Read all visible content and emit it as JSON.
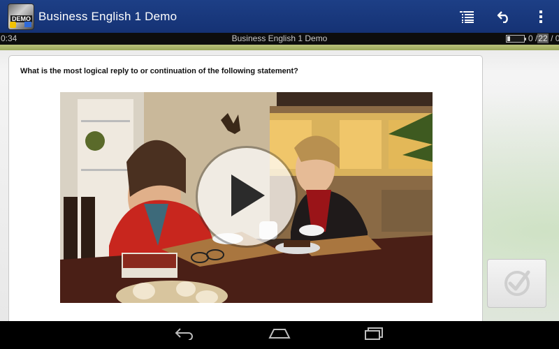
{
  "action_bar": {
    "title": "Business English 1 Demo",
    "icon_badge_text": "DEMO",
    "actions": [
      {
        "icon": "list-icon"
      },
      {
        "icon": "undo-icon"
      },
      {
        "icon": "overflow-menu-icon"
      }
    ]
  },
  "progress": {
    "timer": "0:34",
    "lesson_title": "Business English 1 Demo",
    "score_current": "0",
    "score_sep": "/",
    "score_total": "22",
    "score_extra": "/ 0"
  },
  "question": {
    "prompt": "What is the most logical reply to or continuation of the following statement?"
  },
  "video": {
    "play_icon": "play-icon"
  },
  "submit": {
    "icon": "check-circle-icon"
  },
  "nav": {
    "icons": [
      "back-icon",
      "home-icon",
      "recent-apps-icon"
    ]
  },
  "colors": {
    "action_bar": "#1a3a80",
    "accent": "#a9b46a",
    "background": "#ececec"
  }
}
